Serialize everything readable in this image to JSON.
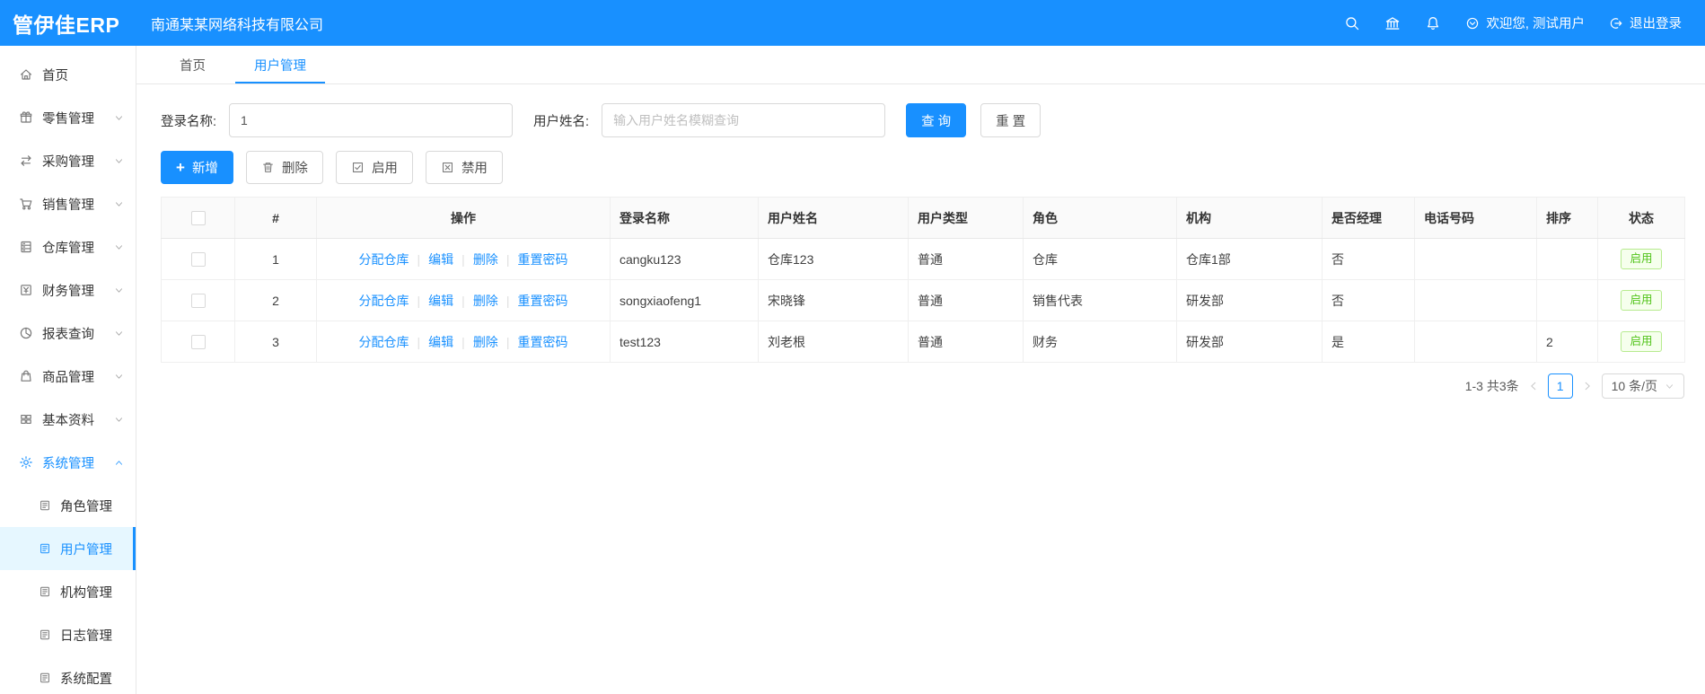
{
  "header": {
    "logo": "管伊佳ERP",
    "company": "南通某某网络科技有限公司",
    "welcome": "欢迎您, 测试用户",
    "logout": "退出登录",
    "accent_color": "#1890ff"
  },
  "sidebar": {
    "items": [
      {
        "label": "首页",
        "icon": "home-icon"
      },
      {
        "label": "零售管理",
        "icon": "gift-icon",
        "expandable": true
      },
      {
        "label": "采购管理",
        "icon": "swap-icon",
        "expandable": true
      },
      {
        "label": "销售管理",
        "icon": "cart-icon",
        "expandable": true
      },
      {
        "label": "仓库管理",
        "icon": "warehouse-icon",
        "expandable": true
      },
      {
        "label": "财务管理",
        "icon": "finance-icon",
        "expandable": true
      },
      {
        "label": "报表查询",
        "icon": "pie-chart-icon",
        "expandable": true
      },
      {
        "label": "商品管理",
        "icon": "bag-icon",
        "expandable": true
      },
      {
        "label": "基本资料",
        "icon": "grid-icon",
        "expandable": true
      },
      {
        "label": "系统管理",
        "icon": "gear-icon",
        "expandable": true,
        "expanded": true,
        "active": true,
        "children": [
          {
            "label": "角色管理"
          },
          {
            "label": "用户管理",
            "active": true
          },
          {
            "label": "机构管理"
          },
          {
            "label": "日志管理"
          },
          {
            "label": "系统配置"
          }
        ]
      }
    ]
  },
  "tabs": [
    {
      "label": "首页"
    },
    {
      "label": "用户管理",
      "active": true
    }
  ],
  "filter": {
    "login_label": "登录名称:",
    "login_value": "1",
    "name_label": "用户姓名:",
    "name_placeholder": "输入用户姓名模糊查询",
    "search_label": "查 询",
    "reset_label": "重 置"
  },
  "toolbar": {
    "add_label": "新增",
    "delete_label": "删除",
    "enable_label": "启用",
    "disable_label": "禁用"
  },
  "table": {
    "headers": [
      "#",
      "操作",
      "登录名称",
      "用户姓名",
      "用户类型",
      "角色",
      "机构",
      "是否经理",
      "电话号码",
      "排序",
      "状态"
    ],
    "action_links": [
      "分配仓库",
      "编辑",
      "删除",
      "重置密码"
    ],
    "rows": [
      {
        "index": "1",
        "login": "cangku123",
        "name": "仓库123",
        "type": "普通",
        "role": "仓库",
        "org": "仓库1部",
        "manager": "否",
        "phone": "",
        "sort": "",
        "status": "启用"
      },
      {
        "index": "2",
        "login": "songxiaofeng1",
        "name": "宋晓锋",
        "type": "普通",
        "role": "销售代表",
        "org": "研发部",
        "manager": "否",
        "phone": "",
        "sort": "",
        "status": "启用"
      },
      {
        "index": "3",
        "login": "test123",
        "name": "刘老根",
        "type": "普通",
        "role": "财务",
        "org": "研发部",
        "manager": "是",
        "phone": "",
        "sort": "2",
        "status": "启用"
      }
    ],
    "status_colors": {
      "text": "#52c41a",
      "border": "#b7eb8f",
      "background": "#f6ffed"
    }
  },
  "pagination": {
    "total": "1-3 共3条",
    "page": "1",
    "page_size": "10 条/页"
  }
}
